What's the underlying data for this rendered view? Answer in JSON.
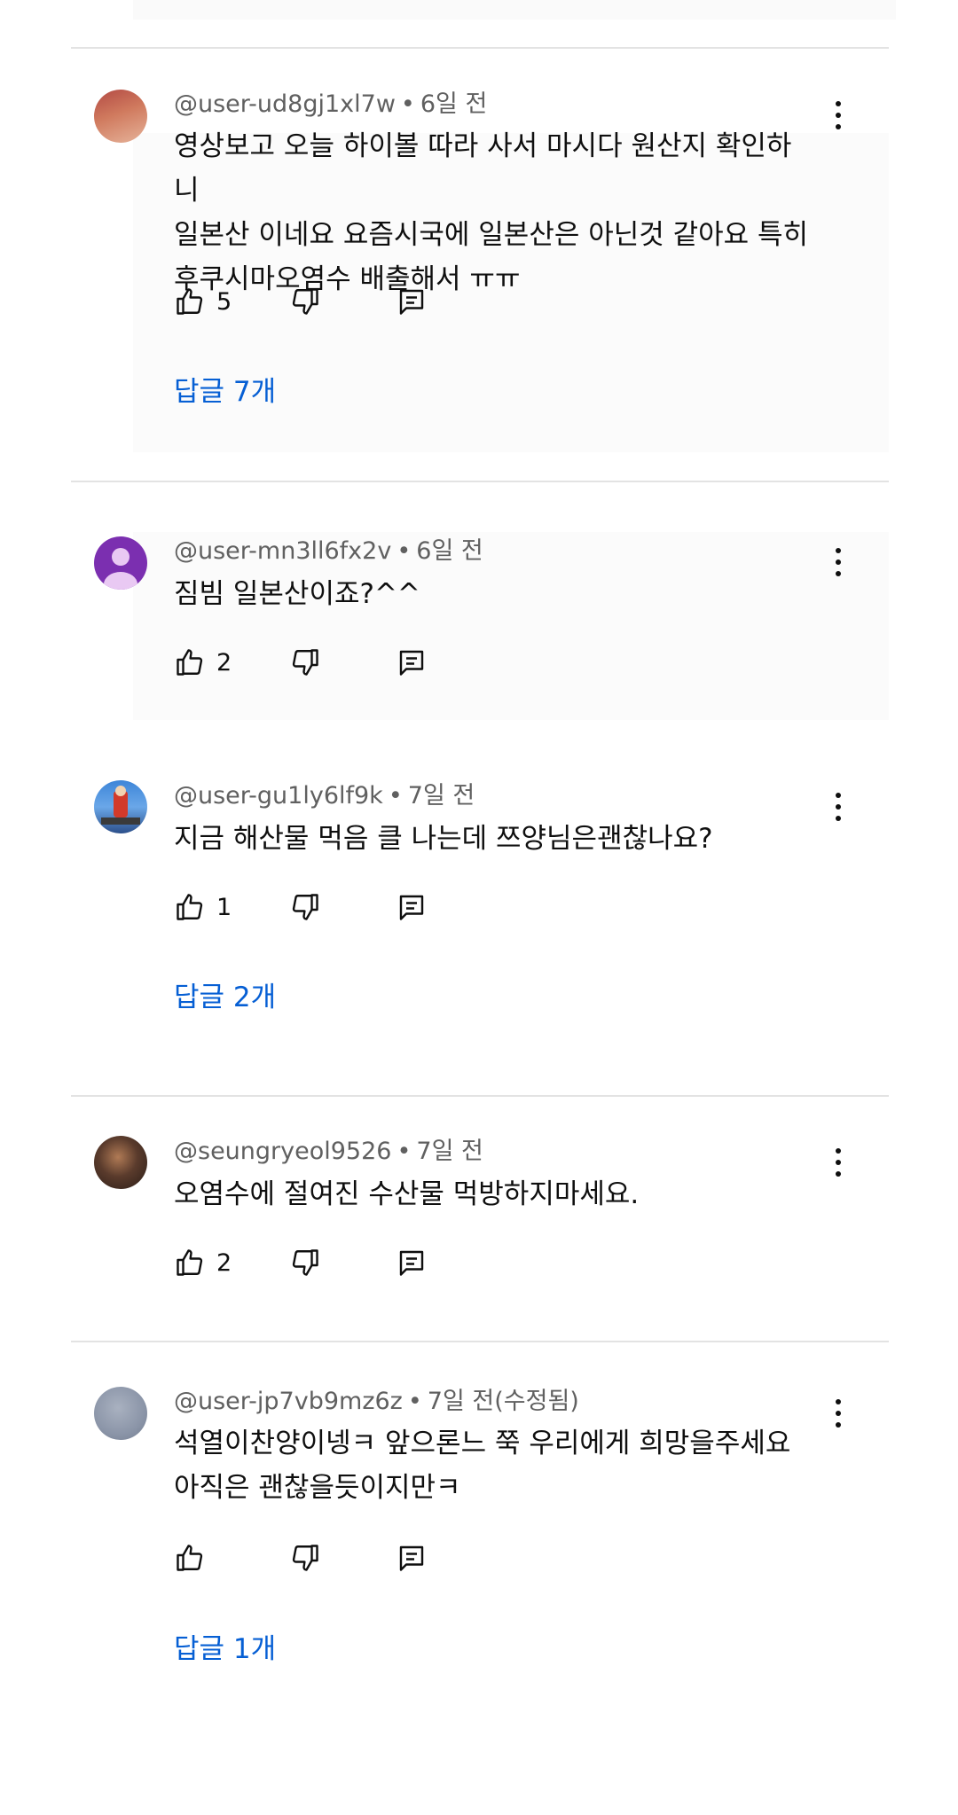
{
  "comments": [
    {
      "author": "@user-ud8gj1xl7w",
      "time": "6일 전",
      "lines": [
        "영상보고 오늘 하이볼 따라 사서 마시다 원산지 확인하니",
        "일본산 이네요 요즘시국에 일본산은 아닌것 같아요 특히",
        "후쿠시마오염수 배출해서 ㅠㅠ"
      ],
      "likes": "5",
      "replies": "답글 7개",
      "avatar_colors": [
        "#c25a4a",
        "#e3a58a"
      ]
    },
    {
      "author": "@user-mn3ll6fx2v",
      "time": "6일 전",
      "lines": [
        "짐빔 일본산이죠?^^"
      ],
      "likes": "2",
      "replies": "",
      "avatar_colors": [
        "#7b2fb0",
        "#e9c9f3"
      ]
    },
    {
      "author": "@user-gu1ly6lf9k",
      "time": "7일 전",
      "lines": [
        "지금 해산물 먹음 클 나는데 쯔양님은괜찮나요?"
      ],
      "likes": "1",
      "replies": "답글 2개",
      "avatar_colors": [
        "#2d6fc8",
        "#d23a2a"
      ]
    },
    {
      "author": "@seungryeol9526",
      "time": "7일 전",
      "lines": [
        "오염수에 절여진 수산물 먹방하지마세요."
      ],
      "likes": "2",
      "replies": "",
      "avatar_colors": [
        "#3a2a22",
        "#9a6b4a"
      ]
    },
    {
      "author": "@user-jp7vb9mz6z",
      "time": "7일 전(수정됨)",
      "lines": [
        "석열이찬양이넹ㅋ 앞으론느 쭉 우리에게 희망을주세요",
        "아직은 괜찮을듯이지만ㅋ"
      ],
      "likes": "",
      "replies": "답글 1개",
      "avatar_colors": [
        "#8b95a8",
        "#b9c0cc"
      ]
    }
  ],
  "icons": {
    "like": "thumbs-up-icon",
    "dislike": "thumbs-down-icon",
    "reply": "reply-comment-icon",
    "menu": "more-vert-icon"
  },
  "colors": {
    "link": "#065fd4",
    "meta": "#606060",
    "divider": "#e3e3e3"
  }
}
